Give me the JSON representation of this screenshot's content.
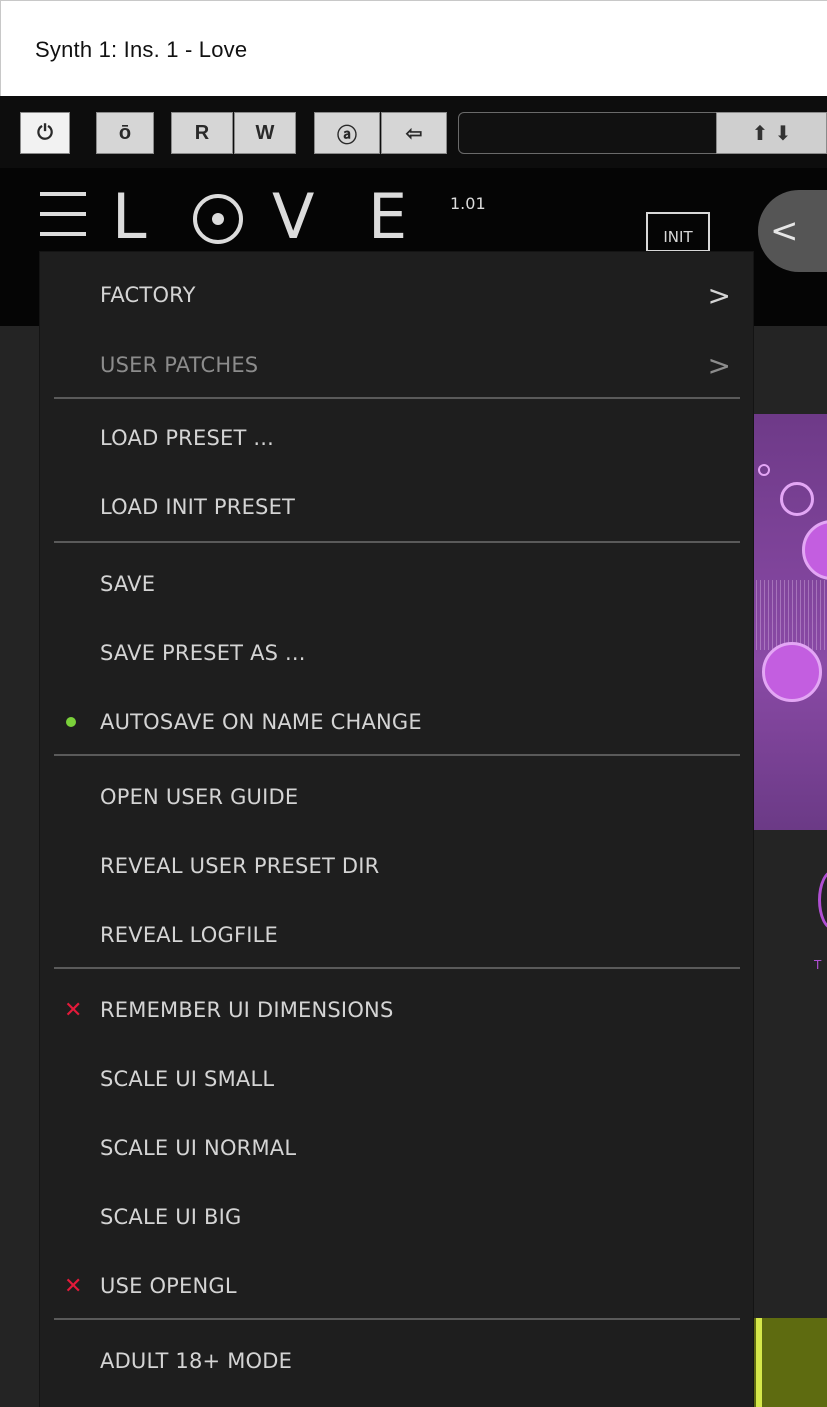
{
  "window": {
    "title": "Synth 1: Ins. 1 - Love"
  },
  "toolbar": {
    "buttons": [
      {
        "name": "power",
        "glyph": "⏻"
      },
      {
        "name": "bypass",
        "glyph": "ō"
      },
      {
        "name": "read",
        "glyph": "R"
      },
      {
        "name": "write",
        "glyph": "W"
      },
      {
        "name": "auto",
        "glyph": "ⓐ"
      },
      {
        "name": "back",
        "glyph": "⇦"
      }
    ],
    "arrows": "⬆ ⬇"
  },
  "plugin": {
    "logo_letters": [
      "L",
      "V",
      "E"
    ],
    "version": "1.01",
    "init_label": "INIT",
    "nav_glyph": "<",
    "knob_label": "T"
  },
  "menu": {
    "items": [
      {
        "label": "FACTORY",
        "submenu": true,
        "chevron": ">"
      },
      {
        "label": "USER PATCHES",
        "submenu": true,
        "chevron": ">",
        "disabled": true
      },
      {
        "label": "LOAD PRESET ..."
      },
      {
        "label": "LOAD INIT PRESET"
      },
      {
        "label": "SAVE"
      },
      {
        "label": "SAVE PRESET AS ..."
      },
      {
        "label": "AUTOSAVE ON NAME CHANGE",
        "marker": "checked",
        "marker_color": "#7ad03a"
      },
      {
        "label": "OPEN USER GUIDE"
      },
      {
        "label": "REVEAL USER PRESET DIR"
      },
      {
        "label": "REVEAL LOGFILE"
      },
      {
        "label": "REMEMBER UI DIMENSIONS",
        "marker": "unchecked",
        "marker_glyph": "✕",
        "marker_color": "#e31a3a"
      },
      {
        "label": "SCALE UI SMALL"
      },
      {
        "label": "SCALE UI NORMAL"
      },
      {
        "label": "SCALE UI BIG"
      },
      {
        "label": "USE OPENGL",
        "marker": "unchecked",
        "marker_glyph": "✕",
        "marker_color": "#e31a3a"
      },
      {
        "label": "ADULT 18+ MODE"
      }
    ]
  },
  "colors": {
    "accent_purple": "#8a4aa6",
    "check_green": "#7ad03a",
    "cross_red": "#e31a3a",
    "menu_bg": "#1e1e1e"
  }
}
